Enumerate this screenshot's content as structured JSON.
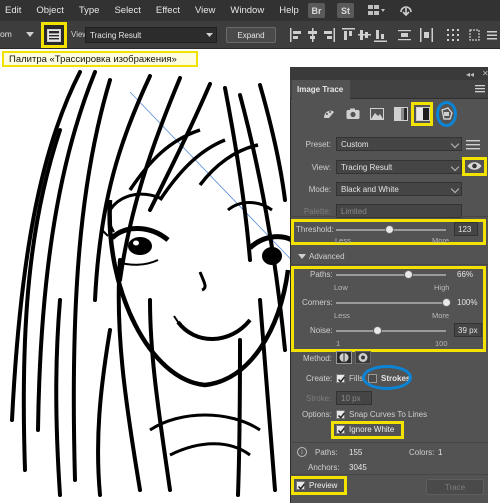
{
  "menubar": {
    "items": [
      "Edit",
      "Object",
      "Type",
      "Select",
      "Effect",
      "View",
      "Window",
      "Help"
    ],
    "bridge_icons": [
      "Br",
      "St"
    ]
  },
  "controlbar": {
    "preset_value": "om",
    "view_label": "View:",
    "view_value": "Tracing Result",
    "expand_label": "Expand"
  },
  "tooltip": "Палитра «Трассировка изображения»",
  "panel": {
    "tab": "Image Trace",
    "preset_label": "Preset:",
    "preset_value": "Custom",
    "view_label": "View:",
    "view_value": "Tracing Result",
    "mode_label": "Mode:",
    "mode_value": "Black and White",
    "palette_label": "Palette:",
    "palette_value": "Limited",
    "threshold": {
      "label": "Threshold:",
      "value": "123",
      "min_label": "Less",
      "max_label": "More",
      "level": 0.49
    },
    "advanced_label": "Advanced",
    "paths": {
      "label": "Paths:",
      "value": "66%",
      "min_label": "Low",
      "max_label": "High",
      "level": 0.66
    },
    "corners": {
      "label": "Corners:",
      "value": "100%",
      "min_label": "Less",
      "max_label": "More",
      "level": 1.0
    },
    "noise": {
      "label": "Noise:",
      "value": "39 px",
      "min_label": "1",
      "max_label": "100",
      "level": 0.38
    },
    "method_label": "Method:",
    "create_label": "Create:",
    "fills_label": "Fills",
    "fills_checked": true,
    "strokes_label": "Strokes",
    "strokes_checked": false,
    "stroke_label": "Stroke:",
    "stroke_value": "10 px",
    "options_label": "Options:",
    "snap_label": "Snap Curves To Lines",
    "snap_checked": true,
    "ignore_white_label": "Ignore White",
    "ignore_white_checked": true,
    "paths_stat_label": "Paths:",
    "paths_stat_value": "155",
    "colors_stat_label": "Colors:",
    "colors_stat_value": "1",
    "anchors_stat_label": "Anchors:",
    "anchors_stat_value": "3045",
    "preview_label": "Preview",
    "preview_checked": true,
    "trace_label": "Trace"
  },
  "colors": {
    "highlight": "#f2e200",
    "circle": "#0b84d6",
    "panel_bg": "#535353"
  }
}
